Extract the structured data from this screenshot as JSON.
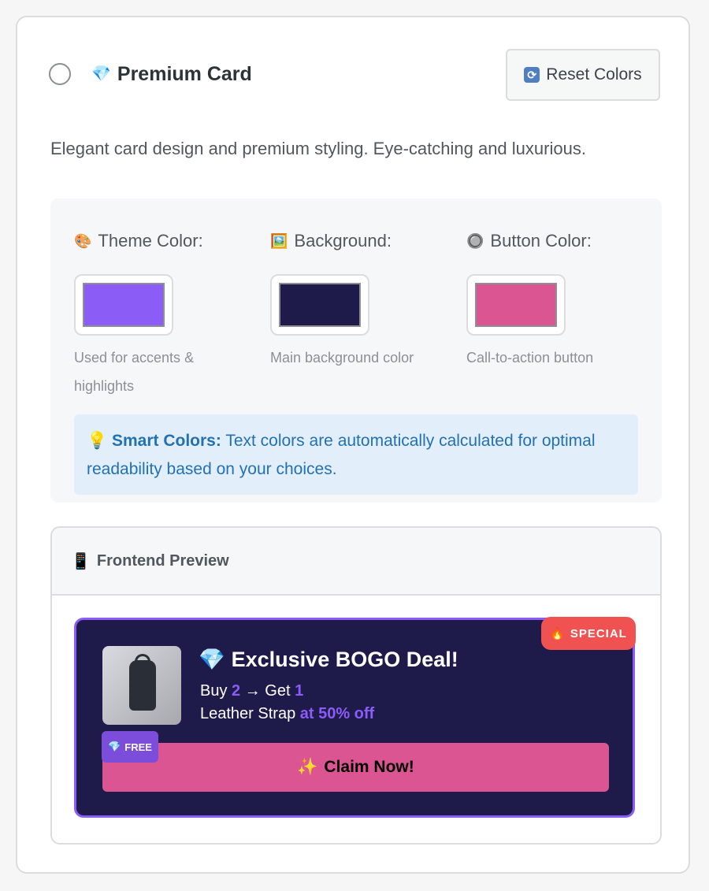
{
  "header": {
    "title_icon": "gem-icon",
    "title": "Premium Card",
    "reset_label": "Reset Colors",
    "reset_icon": "refresh-icon"
  },
  "description": "Elegant card design and premium styling. Eye-catching and luxurious.",
  "colors": [
    {
      "icon": "palette-icon",
      "label": "Theme Color:",
      "value": "#8b5cf6",
      "hint": "Used for accents & highlights"
    },
    {
      "icon": "picture-icon",
      "label": "Background:",
      "value": "#1e1b4b",
      "hint": "Main background color"
    },
    {
      "icon": "radio-button-icon",
      "label": "Button Color:",
      "value": "#db5593",
      "hint": "Call-to-action button"
    }
  ],
  "smart_colors": {
    "icon": "bulb-icon",
    "label": "Smart Colors:",
    "text": " Text colors are automatically calculated for optimal readability based on your choices."
  },
  "preview": {
    "title": "Frontend Preview",
    "title_icon": "phone-icon",
    "badge": "SPECIAL",
    "badge_icon": "fire-icon",
    "deal_title": "Exclusive BOGO Deal!",
    "deal_title_icon": "gem-icon",
    "buy_prefix": "Buy ",
    "buy_qty": "2",
    "arrow": " → Get ",
    "get_qty": "1",
    "product": "Leather Strap ",
    "discount": "at 50% off",
    "free_label": "FREE",
    "free_icon": "gem-icon",
    "cta_icon": "sparkles-icon",
    "cta": "Claim Now!"
  }
}
